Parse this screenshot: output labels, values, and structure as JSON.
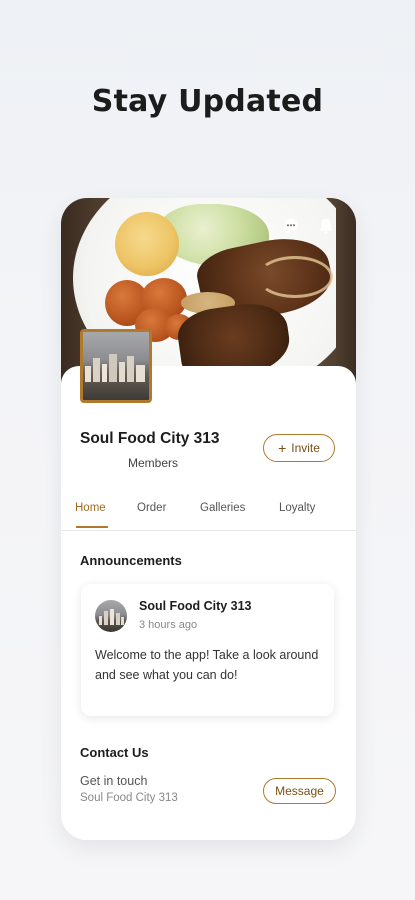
{
  "headline": "Stay Updated",
  "top_icons": [
    "chat-icon",
    "bell-icon"
  ],
  "profile": {
    "name": "Soul Food City 313",
    "members_label": "Members",
    "invite_label": "Invite",
    "invite_icon": "plus-icon"
  },
  "tabs": [
    {
      "label": "Home",
      "active": true
    },
    {
      "label": "Order",
      "active": false
    },
    {
      "label": "Galleries",
      "active": false
    },
    {
      "label": "Loyalty",
      "active": false
    }
  ],
  "announcements": {
    "title": "Announcements",
    "post": {
      "author": "Soul Food City 313",
      "time": "3 hours ago",
      "body": "Welcome to the app! Take a look around and see what you can do!"
    }
  },
  "contact": {
    "title": "Contact Us",
    "subtitle": "Get in touch",
    "business": "Soul Food City 313",
    "message_label": "Message"
  },
  "colors": {
    "accent": "#b07a2e",
    "accent_text": "#7a4f14",
    "background": "#f3f4f7"
  }
}
